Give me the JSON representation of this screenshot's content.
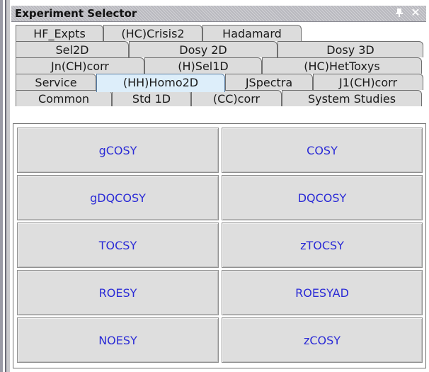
{
  "window": {
    "title": "Experiment Selector",
    "pin_icon": "pin-icon",
    "close_icon": "close-icon",
    "close_glyph": "✕"
  },
  "tab_rows": [
    [
      "HF_Expts",
      "(HC)Crisis2",
      "Hadamard"
    ],
    [
      "Sel2D",
      "Dosy 2D",
      "Dosy 3D"
    ],
    [
      "Jn(CH)corr",
      "(H)Sel1D",
      "(HC)HetToxys"
    ],
    [
      "Service",
      "(HH)Homo2D",
      "JSpectra",
      "J1(CH)corr"
    ],
    [
      "Common",
      "Std 1D",
      "(CC)corr",
      "System Studies"
    ]
  ],
  "selected_tab": "(HH)Homo2D",
  "buttons": [
    [
      "gCOSY",
      "COSY"
    ],
    [
      "gDQCOSY",
      "DQCOSY"
    ],
    [
      "TOCSY",
      "zTOCSY"
    ],
    [
      "ROESY",
      "ROESYAD"
    ],
    [
      "NOESY",
      "zCOSY"
    ]
  ],
  "colors": {
    "button_text": "#2b2bd6",
    "selected_tab_bg": "#ddeefa",
    "tab_bg": "#dcdcdc",
    "button_bg": "#dedede"
  }
}
